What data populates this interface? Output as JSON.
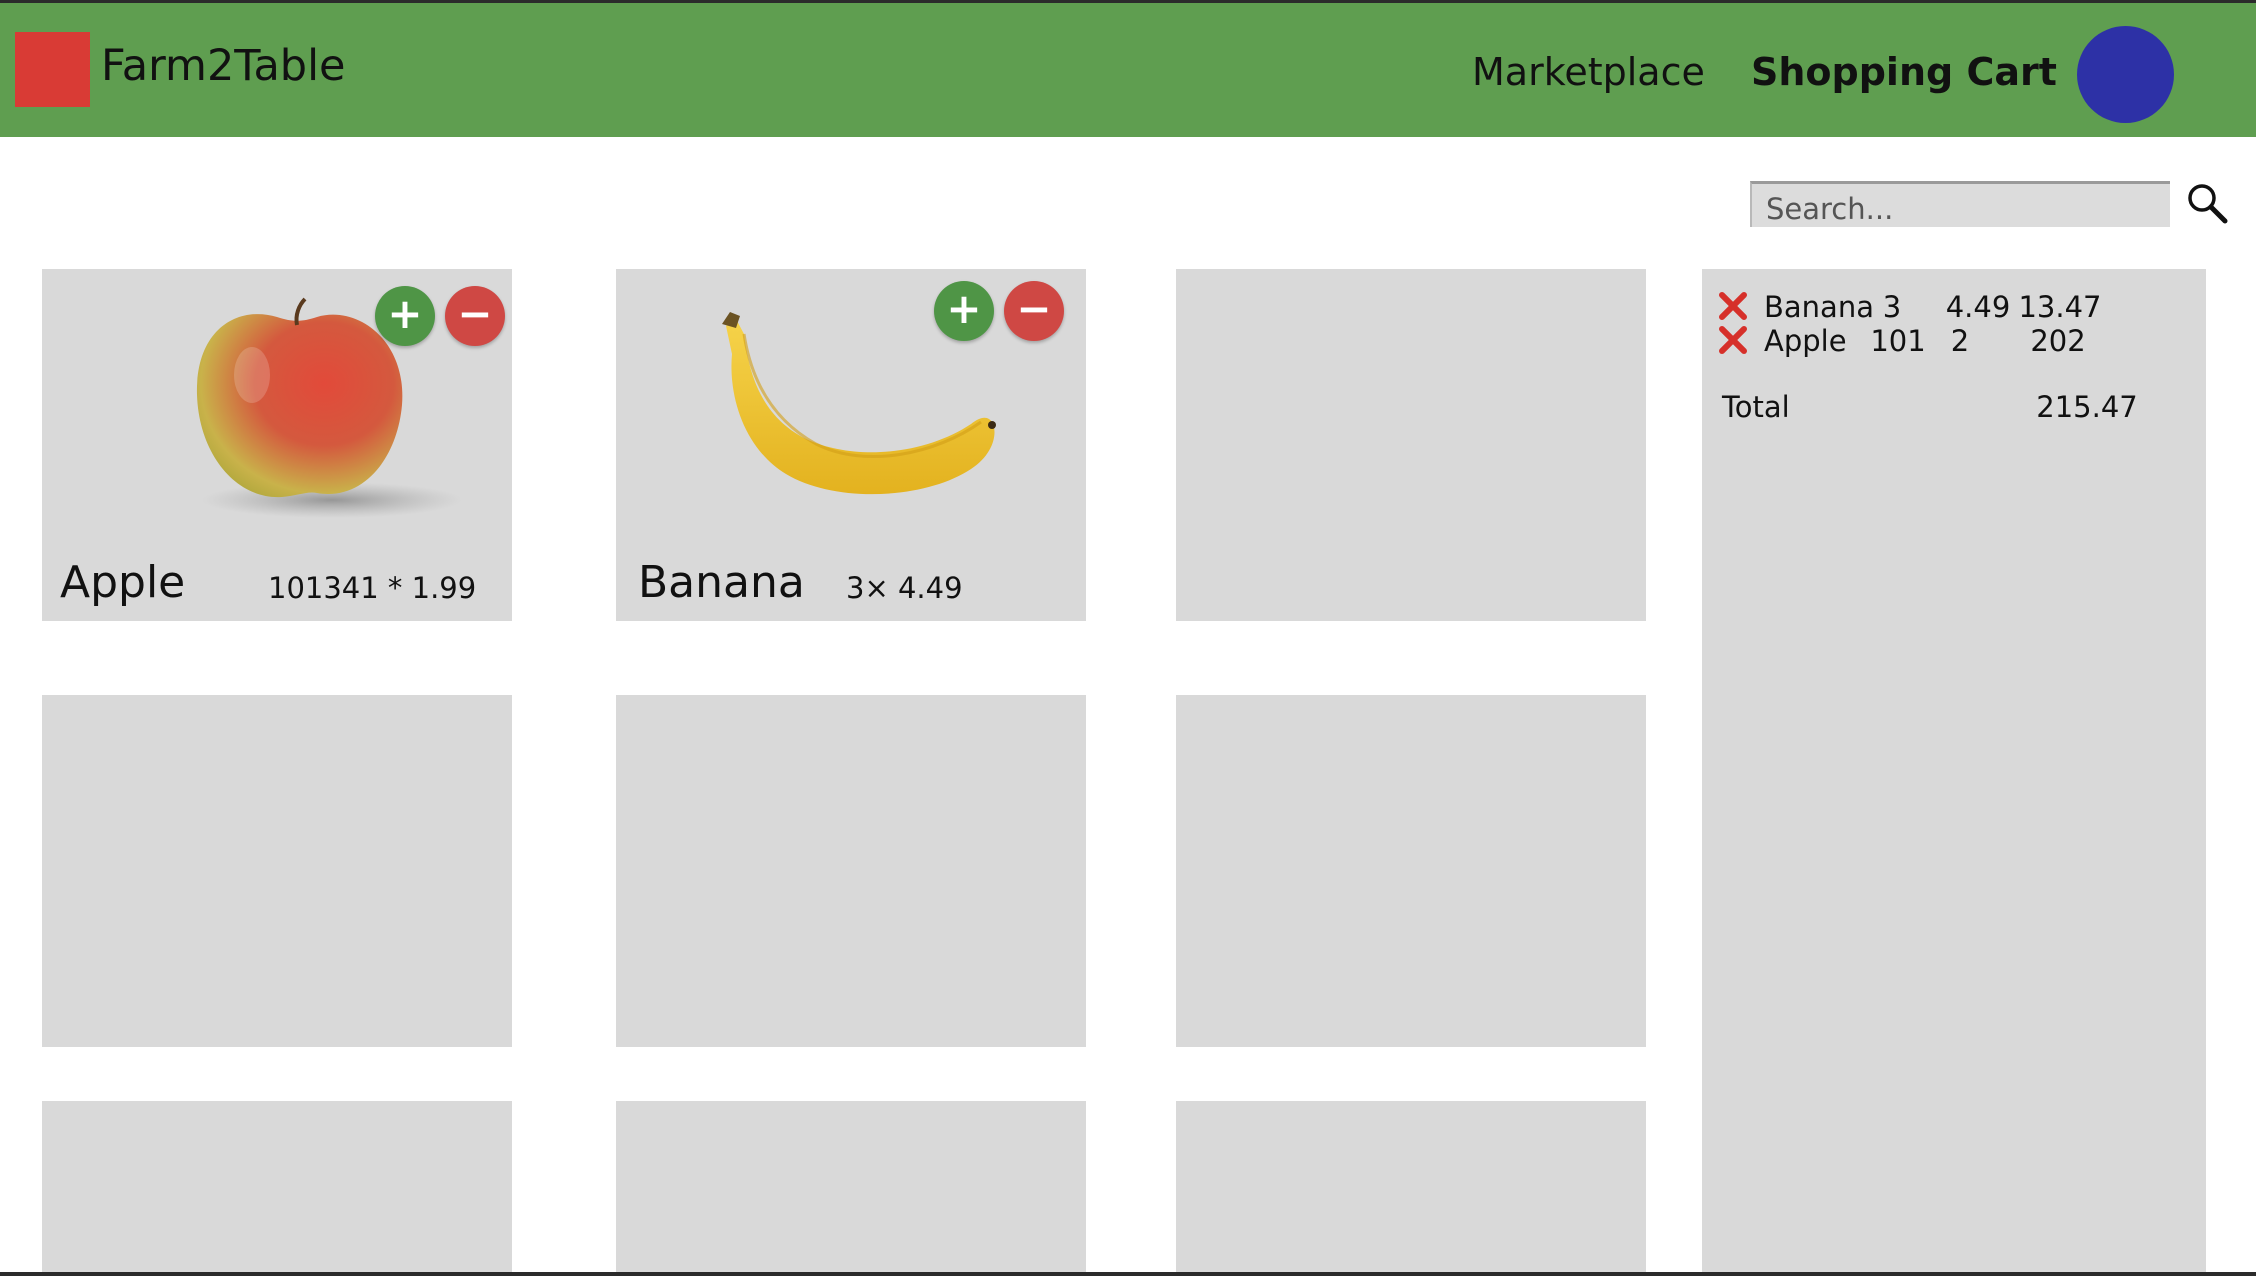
{
  "app": {
    "brand": "Farm2Table"
  },
  "nav": {
    "marketplace": "Marketplace",
    "shopping_cart": "Shopping Cart"
  },
  "search": {
    "placeholder": "Search..."
  },
  "products": [
    {
      "name": "Apple",
      "price_line": "101341 * 1.99",
      "plus_label": "+",
      "minus_label": "−",
      "image_icon": "apple-image"
    },
    {
      "name": "Banana",
      "price_line": "3× 4.49",
      "plus_label": "+",
      "minus_label": "−",
      "image_icon": "banana-image"
    }
  ],
  "cart": {
    "items": [
      {
        "name": "Banana",
        "qty": "3",
        "price": "4.49",
        "subtotal": "13.47"
      },
      {
        "name": "Apple",
        "qty": "101",
        "price": "2",
        "subtotal": "202"
      }
    ],
    "total_label": "Total",
    "total_value": "215.47"
  },
  "colors": {
    "header": "#5f9e50",
    "logo": "#d93b35",
    "avatar": "#2d31a6",
    "card": "#d9d9d9",
    "plus_button": "#4f9546",
    "minus_button": "#cf4844",
    "remove_icon": "#d6302a"
  }
}
